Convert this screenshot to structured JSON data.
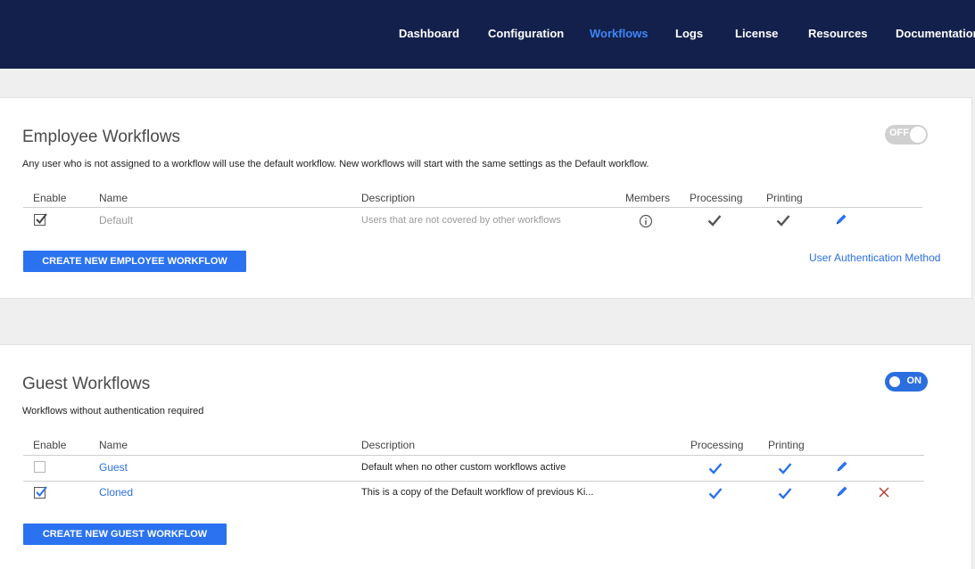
{
  "nav": {
    "items": [
      {
        "label": "Dashboard",
        "active": false
      },
      {
        "label": "Configuration",
        "active": false
      },
      {
        "label": "Workflows",
        "active": true
      },
      {
        "label": "Logs",
        "active": false
      },
      {
        "label": "License",
        "active": false
      },
      {
        "label": "Resources",
        "active": false
      },
      {
        "label": "Documentation",
        "active": false
      }
    ]
  },
  "employee": {
    "title": "Employee Workflows",
    "description": "Any user who is not assigned to a workflow will use the default workflow. New workflows will start with the same settings as the Default workflow.",
    "toggle_label": "OFF",
    "toggle_state": "off",
    "columns": {
      "enable": "Enable",
      "name": "Name",
      "description": "Description",
      "members": "Members",
      "processing": "Processing",
      "printing": "Printing"
    },
    "rows": [
      {
        "enabled": true,
        "name": "Default",
        "description": "Users that are not covered by other workflows",
        "members_icon": "info-icon",
        "processing": true,
        "printing": true
      }
    ],
    "create_button": "CREATE NEW EMPLOYEE WORKFLOW",
    "auth_link": "User Authentication Method"
  },
  "guest": {
    "title": "Guest Workflows",
    "description": "Workflows without authentication required",
    "toggle_label": "ON",
    "toggle_state": "on",
    "columns": {
      "enable": "Enable",
      "name": "Name",
      "description": "Description",
      "processing": "Processing",
      "printing": "Printing"
    },
    "rows": [
      {
        "enabled": false,
        "name": "Guest",
        "description": "Default when no other custom workflows active",
        "processing": true,
        "printing": true,
        "deletable": false
      },
      {
        "enabled": true,
        "name": "Cloned",
        "description": "This is a copy of the Default workflow of previous Ki...",
        "processing": true,
        "printing": true,
        "deletable": true
      }
    ],
    "create_button": "CREATE NEW GUEST WORKFLOW"
  },
  "colors": {
    "nav_bg": "#13204b",
    "accent": "#2a72f0",
    "active_nav": "#3e86f7",
    "delete": "#b03a2e"
  }
}
